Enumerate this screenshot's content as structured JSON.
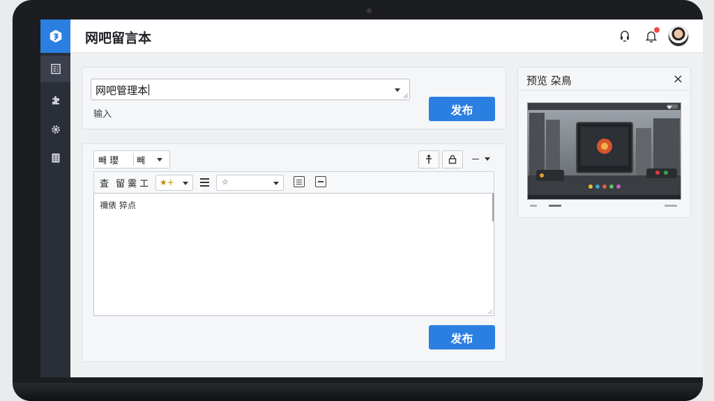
{
  "app": {
    "title": "网吧留言本"
  },
  "sidebar": {
    "items": [
      {
        "icon": "document-list-icon",
        "active": true
      },
      {
        "icon": "puzzle-icon",
        "active": false
      },
      {
        "icon": "gear-icon",
        "active": false
      },
      {
        "icon": "report-icon",
        "active": false
      }
    ]
  },
  "header": {
    "icons": [
      "headset-icon",
      "bell-icon"
    ],
    "has_notification": true
  },
  "top_form": {
    "title_value": "网吧管理本",
    "hint": "输入",
    "publish_label": "发布"
  },
  "editor": {
    "toolbar_row1": {
      "group_label": "빼 瓔",
      "select_label": "빼"
    },
    "toolbar_row2": {
      "labels": [
        "査",
        "留 霙 工"
      ],
      "style_select": "★+",
      "size_select": "☆"
    },
    "content": "禰俵 猝点",
    "publish_label": "发布"
  },
  "preview": {
    "title": "预览 朶鳥",
    "close": "×"
  },
  "colors": {
    "accent": "#2b7fe0",
    "sidebar": "#2a2e37",
    "notification": "#ef4a4a"
  }
}
